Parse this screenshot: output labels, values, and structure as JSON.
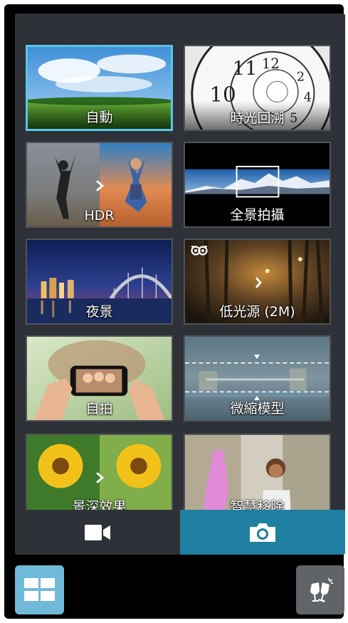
{
  "modes": [
    {
      "label": "自動",
      "selected": true
    },
    {
      "label": "時光回溯",
      "selected": false
    },
    {
      "label": "HDR",
      "selected": false
    },
    {
      "label": "全景拍攝",
      "selected": false
    },
    {
      "label": "夜景",
      "selected": false
    },
    {
      "label": "低光源 (2M)",
      "selected": false
    },
    {
      "label": "自拍",
      "selected": false
    },
    {
      "label": "微縮模型",
      "selected": false
    },
    {
      "label": "景深效果",
      "selected": false
    },
    {
      "label": "智慧移除",
      "selected": false
    }
  ],
  "bottom_bar": {
    "video_icon": "video-camera-icon",
    "photo_icon": "camera-icon",
    "active": "photo"
  },
  "footer": {
    "modes_icon": "grid-icon",
    "effect_icon": "champagne-glasses-icon"
  },
  "colors": {
    "accent": "#59c6e6",
    "active_tab": "#1f7fa0",
    "panel": "#2e3137"
  }
}
